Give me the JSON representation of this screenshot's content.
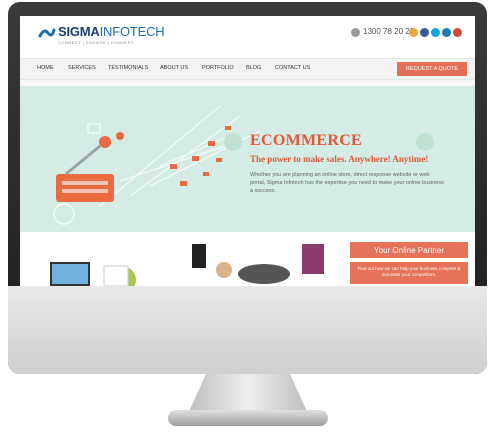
{
  "brand": {
    "name_bold": "SIGMA",
    "name_light": "INFOTECH",
    "tagline": "CONNECT | ENGAGE | CONVERT"
  },
  "contact": {
    "phone": "1300 78 20 23"
  },
  "social_icons": [
    "rss-icon",
    "facebook-icon",
    "skype-icon",
    "linkedin-icon",
    "google-icon"
  ],
  "social_colors": [
    "#f0a43a",
    "#3b5998",
    "#12a5e6",
    "#1a7ab8",
    "#d04b3a"
  ],
  "nav": {
    "items": [
      "HOME",
      "SERVICES",
      "TESTIMONIALS",
      "ABOUT US",
      "PORTFOLIO",
      "BLOG",
      "CONTACT US"
    ],
    "cta": "REQUEST A QUOTE"
  },
  "hero": {
    "title": "ECOMMERCE",
    "subtitle": "The power to make sales. Anywhere! Anytime!",
    "description": "Whether you are planning an online store, direct response website or web portal, Sigma Infotech has the expertise you need to make your online business a success."
  },
  "partner": {
    "title": "Your Online Partner",
    "description": "Find out how we can help your business compete & dominate your competitors."
  },
  "colors": {
    "accent": "#e46f57",
    "hero_bg": "#d4ebe6",
    "brand_blue": "#1c3d7a"
  }
}
